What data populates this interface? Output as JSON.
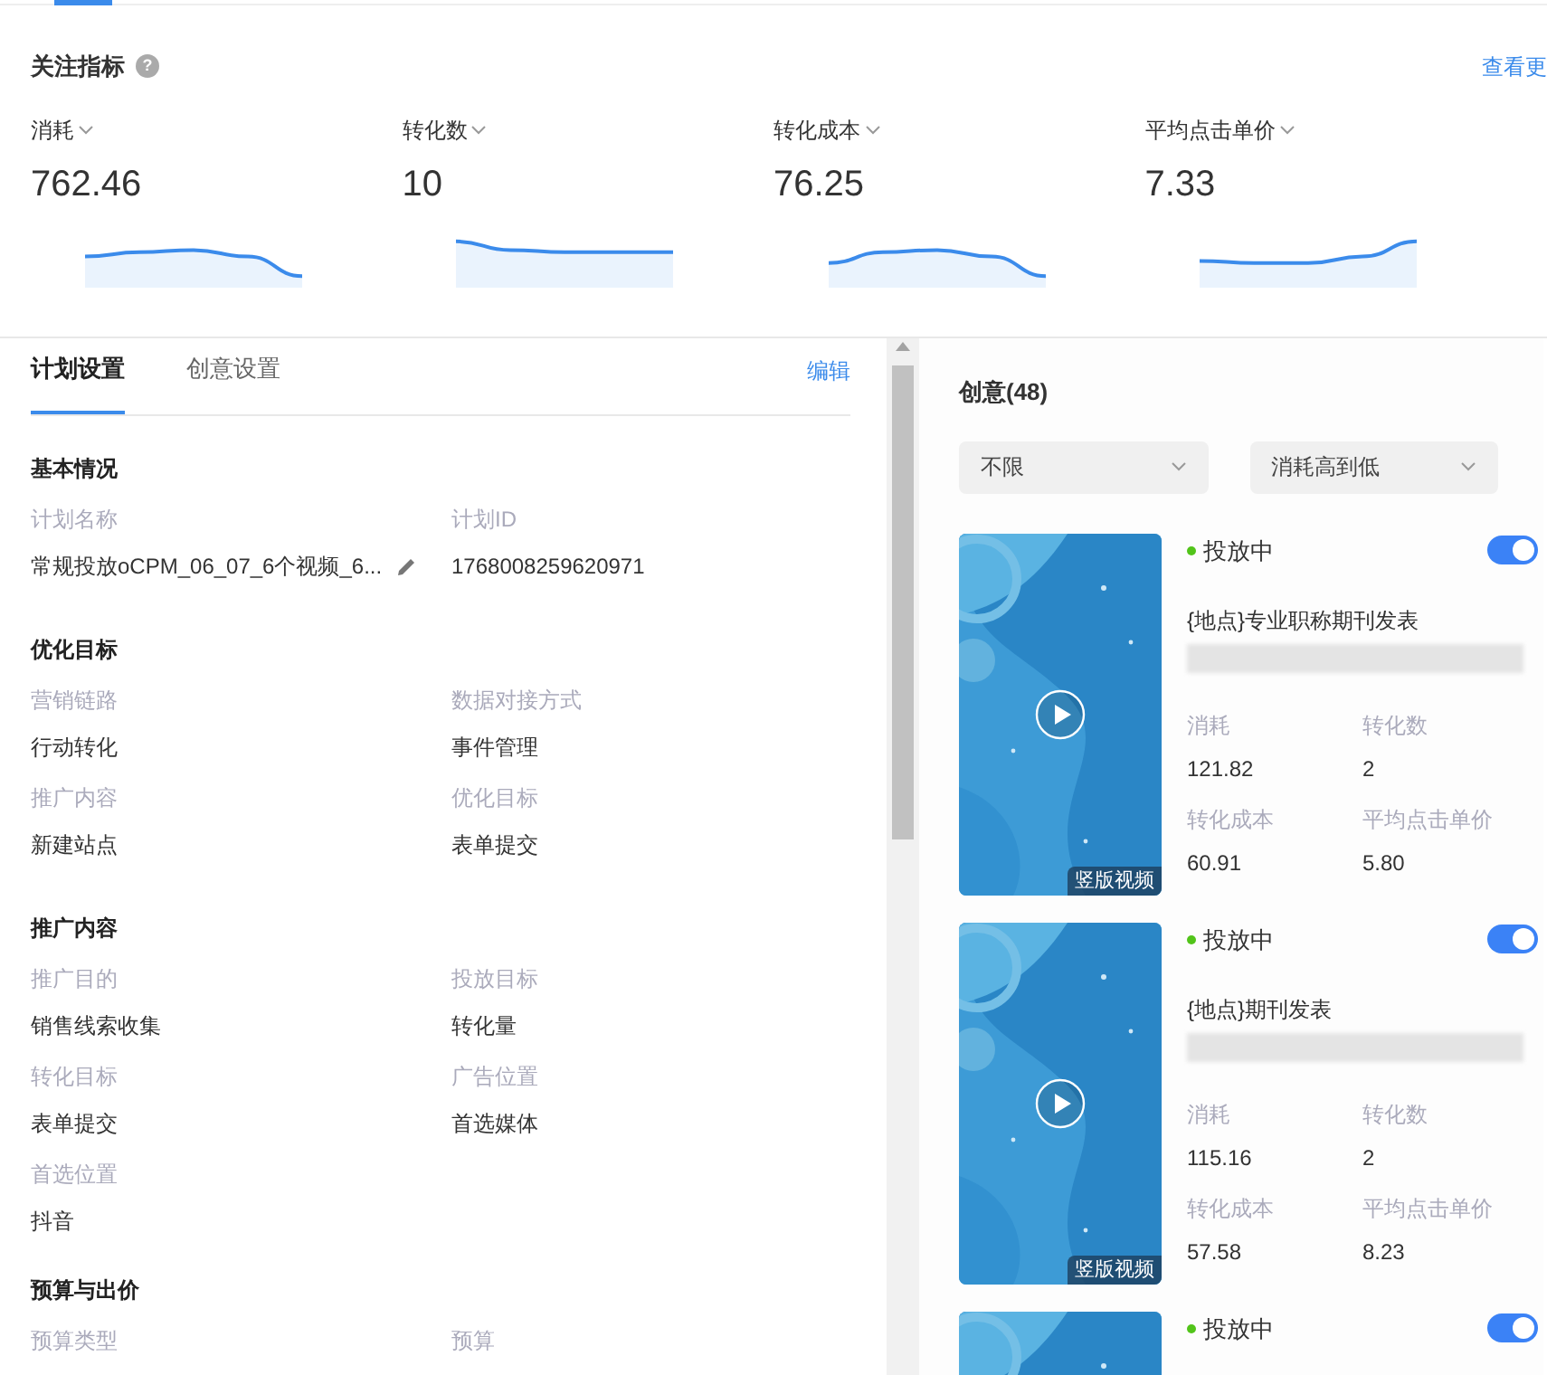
{
  "header": {
    "title": "关注指标",
    "help_icon": "?",
    "more_link": "查看更"
  },
  "metrics": [
    {
      "label": "消耗",
      "value": "762.46"
    },
    {
      "label": "转化数",
      "value": "10"
    },
    {
      "label": "转化成本",
      "value": "76.25"
    },
    {
      "label": "平均点击单价",
      "value": "7.33"
    }
  ],
  "tabs": [
    {
      "label": "计划设置",
      "selected": true
    },
    {
      "label": "创意设置",
      "selected": false
    }
  ],
  "edit_link": "编辑",
  "sections": [
    {
      "title": "基本情况",
      "fields": [
        {
          "label": "计划名称",
          "value": "常规投放oCPM_06_07_6个视频_6...",
          "editable": true
        },
        {
          "label": "计划ID",
          "value": "1768008259620971",
          "editable": false
        }
      ]
    },
    {
      "title": "优化目标",
      "fields": [
        {
          "label": "营销链路",
          "value": "行动转化",
          "editable": false
        },
        {
          "label": "数据对接方式",
          "value": "事件管理",
          "editable": false
        },
        {
          "label": "推广内容",
          "value": "新建站点",
          "editable": false
        },
        {
          "label": "优化目标",
          "value": "表单提交",
          "editable": false
        }
      ]
    },
    {
      "title": "推广内容",
      "fields": [
        {
          "label": "推广目的",
          "value": "销售线索收集",
          "editable": false
        },
        {
          "label": "投放目标",
          "value": "转化量",
          "editable": false
        },
        {
          "label": "转化目标",
          "value": "表单提交",
          "editable": false
        },
        {
          "label": "广告位置",
          "value": "首选媒体",
          "editable": false
        },
        {
          "label": "首选位置",
          "value": "抖音",
          "editable": false
        }
      ]
    },
    {
      "title": "预算与出价",
      "fields": [
        {
          "label": "预算类型"
        },
        {
          "label": "预算"
        }
      ]
    }
  ],
  "creatives": {
    "title": "创意(48)",
    "filters": [
      {
        "value": "不限"
      },
      {
        "value": "消耗高到低"
      }
    ],
    "items": [
      {
        "badge": "竖版视频",
        "status": "投放中",
        "color": "#52c41a",
        "on": true,
        "title": "{地点}专业职称期刊发表",
        "stats": [
          {
            "label": "消耗",
            "value": "121.82"
          },
          {
            "label": "转化数",
            "value": "2"
          },
          {
            "label": "转化成本",
            "value": "60.91"
          },
          {
            "label": "平均点击单价",
            "value": "5.80"
          }
        ]
      },
      {
        "badge": "竖版视频",
        "status": "投放中",
        "color": "#52c41a",
        "on": true,
        "title": "{地点}期刊发表",
        "stats": [
          {
            "label": "消耗",
            "value": "115.16"
          },
          {
            "label": "转化数",
            "value": "2"
          },
          {
            "label": "转化成本",
            "value": "57.58"
          },
          {
            "label": "平均点击单价",
            "value": "8.23"
          }
        ]
      },
      {
        "status": "投放中",
        "color": "#52c41a",
        "on": true
      }
    ]
  }
}
